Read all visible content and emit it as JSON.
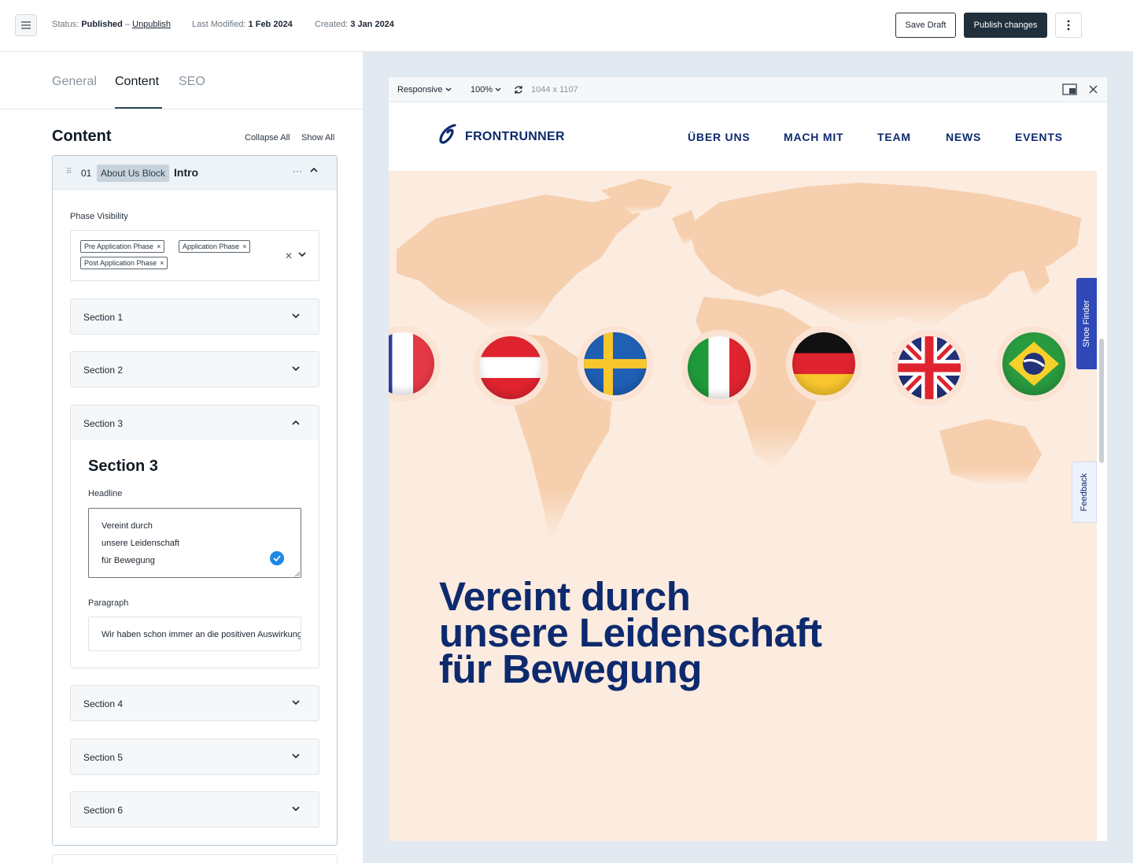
{
  "topbar": {
    "status_label": "Status:",
    "status_value": "Published",
    "status_sep": "–",
    "unpublish": "Unpublish",
    "modified_label": "Last Modified:",
    "modified_value": "1 Feb 2024",
    "created_label": "Created:",
    "created_value": "3 Jan 2024",
    "save_draft": "Save Draft",
    "publish": "Publish changes"
  },
  "tabs": [
    {
      "label": "General"
    },
    {
      "label": "Content"
    },
    {
      "label": "SEO"
    }
  ],
  "content": {
    "title": "Content",
    "collapse_all": "Collapse All",
    "show_all": "Show All",
    "block": {
      "number": "01",
      "tag": "About Us Block",
      "title": "Intro",
      "dots": "···",
      "phase_label": "Phase Visibility",
      "phases": [
        "Pre Application Phase",
        "Application Phase",
        "Post Application Phase"
      ],
      "sections": [
        "Section 1",
        "Section 2",
        "Section 3",
        "Section 4",
        "Section 5",
        "Section 6"
      ],
      "section3": {
        "heading": "Section 3",
        "headline_label": "Headline",
        "headline_lines": [
          "Vereint durch",
          "unsere Leidenschaft",
          "für Bewegung"
        ],
        "paragraph_label": "Paragraph",
        "paragraph_value": "Wir haben schon immer an die positiven Auswirkungen"
      }
    }
  },
  "preview": {
    "mode": "Responsive",
    "zoom": "100%",
    "dimensions": "1044 x 1107",
    "site": {
      "brand": "FRONTRUNNER",
      "nav": [
        "ÜBER UNS",
        "MACH MIT",
        "TEAM",
        "NEWS",
        "EVENTS"
      ],
      "flags": [
        "france-flag",
        "austria-flag",
        "sweden-flag",
        "italy-flag",
        "germany-flag",
        "uk-flag",
        "brazil-flag"
      ],
      "headline_lines": [
        "Vereint durch",
        "unsere Leidenschaft",
        "für Bewegung"
      ],
      "shoe_finder": "Shoe Finder",
      "feedback": "Feedback"
    }
  },
  "colors": {
    "brand_navy": "#0e2a6e",
    "publish_bg": "#1f2f3b",
    "hero_bg": "#fcebdf",
    "check_blue": "#1e88e5",
    "shoe_finder_bg": "#2f49b8"
  }
}
